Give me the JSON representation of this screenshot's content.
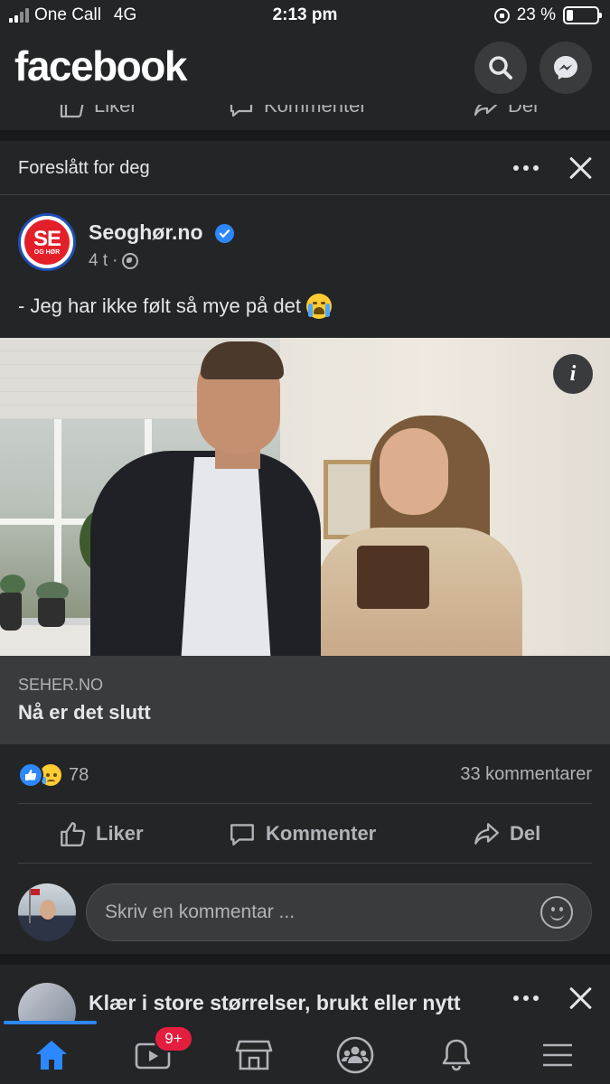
{
  "status_bar": {
    "carrier": "One Call",
    "network": "4G",
    "time": "2:13 pm",
    "battery": "23 %",
    "battery_level": 0.23
  },
  "header": {
    "logo": "facebook",
    "icons": [
      "search-icon",
      "messenger-icon"
    ]
  },
  "previous_post": {
    "actions": [
      "Liker",
      "Kommenter",
      "Del"
    ]
  },
  "post": {
    "suggested_label": "Foreslått for deg",
    "page_name": "Seoghør.no",
    "avatar_text": "SE",
    "avatar_subtext": "OG HØR",
    "time": "4 t",
    "separator": "·",
    "text": "- Jeg har ikke følt så mye på det",
    "link": {
      "domain": "SEHER.NO",
      "title": "Nå er det slutt"
    },
    "reactions_count": "78",
    "comments_count": "33 kommentarer",
    "actions": {
      "like": "Liker",
      "comment": "Kommenter",
      "share": "Del"
    },
    "comment_placeholder": "Skriv en kommentar ..."
  },
  "next_post": {
    "title": "Klær i store størrelser, brukt eller nytt"
  },
  "tabbar": {
    "video_badge": "9+",
    "tabs": [
      "home-icon",
      "video-icon",
      "marketplace-icon",
      "groups-icon",
      "notifications-icon",
      "menu-icon"
    ]
  },
  "colors": {
    "background": "#18191a",
    "card": "#242526",
    "accent": "#2d88ff",
    "badge": "#e41e3f",
    "text_primary": "#e4e6eb",
    "text_secondary": "#b0b3b8"
  }
}
